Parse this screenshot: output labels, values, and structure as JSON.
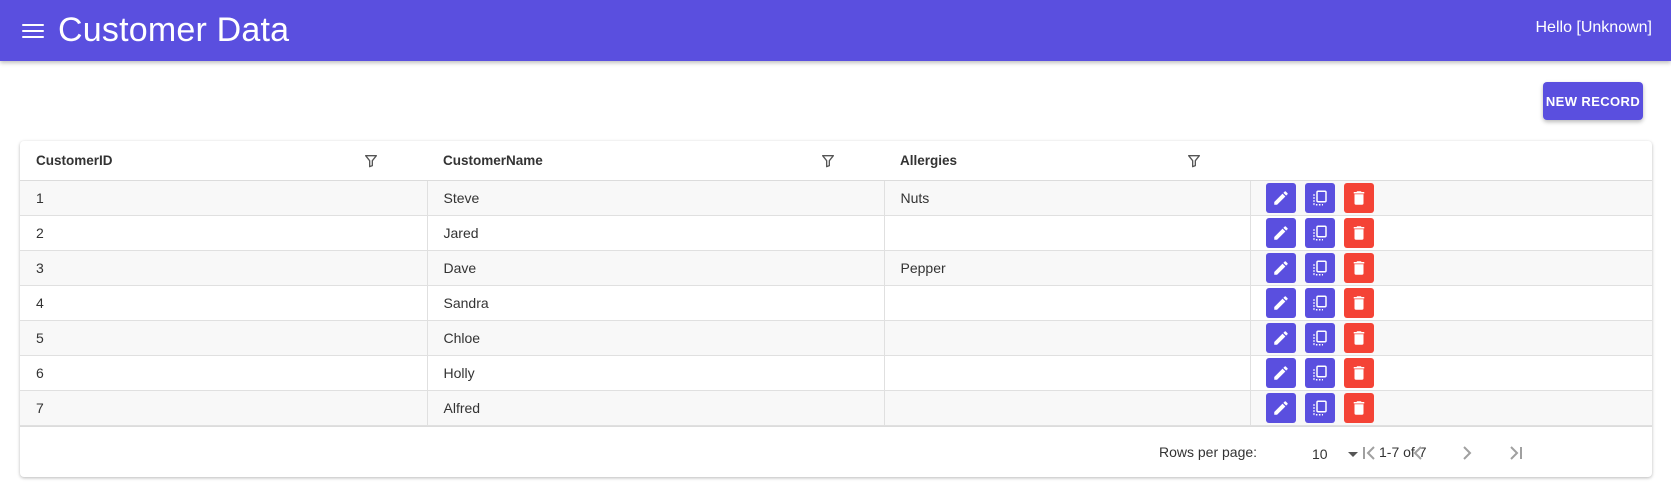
{
  "header": {
    "title": "Customer Data",
    "greeting": "Hello [Unknown]",
    "menu_icon": "hamburger-menu-icon"
  },
  "toolbar": {
    "new_record_label": "NEW RECORD"
  },
  "table": {
    "columns": [
      {
        "label": "CustomerID",
        "filter_icon": "filter-icon"
      },
      {
        "label": "CustomerName",
        "filter_icon": "filter-icon"
      },
      {
        "label": "Allergies",
        "filter_icon": "filter-icon"
      }
    ],
    "rows": [
      {
        "id": "1",
        "name": "Steve",
        "allergies": "Nuts"
      },
      {
        "id": "2",
        "name": "Jared",
        "allergies": ""
      },
      {
        "id": "3",
        "name": "Dave",
        "allergies": "Pepper"
      },
      {
        "id": "4",
        "name": "Sandra",
        "allergies": ""
      },
      {
        "id": "5",
        "name": "Chloe",
        "allergies": ""
      },
      {
        "id": "6",
        "name": "Holly",
        "allergies": ""
      },
      {
        "id": "7",
        "name": "Alfred",
        "allergies": ""
      }
    ],
    "row_action_icons": [
      "edit-icon",
      "copy-icon",
      "delete-icon"
    ]
  },
  "pagination": {
    "rows_per_page_label": "Rows per page:",
    "rows_per_page_value": "10",
    "range_label": "1-7 of 7",
    "nav_icons": [
      "first-page-icon",
      "previous-page-icon",
      "next-page-icon",
      "last-page-icon"
    ]
  },
  "colors": {
    "primary": "#5a4fdf",
    "danger": "#f44336"
  }
}
